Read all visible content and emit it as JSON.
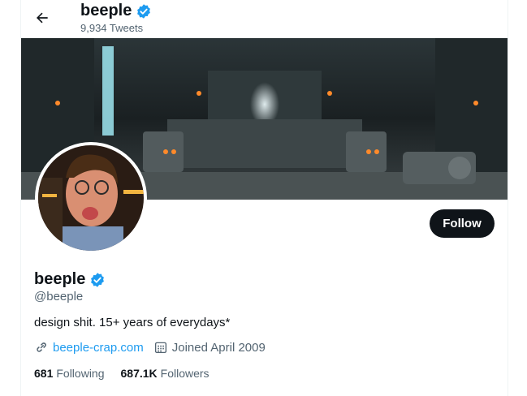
{
  "header": {
    "name": "beeple",
    "tweet_count": "9,934 Tweets"
  },
  "profile": {
    "display_name": "beeple",
    "handle": "@beeple",
    "bio": "design shit. 15+ years of everydays*",
    "website": "beeple-crap.com",
    "joined": "Joined April 2009",
    "following_count": "681",
    "following_label": "Following",
    "followers_count": "687.1K",
    "followers_label": "Followers"
  },
  "actions": {
    "follow_label": "Follow"
  },
  "icons": {
    "back": "arrow-left-icon",
    "verified": "verified-badge-icon",
    "link": "link-icon",
    "calendar": "calendar-icon"
  },
  "colors": {
    "accent": "#1d9bf0",
    "text": "#0f1419",
    "secondary": "#536471",
    "follow_bg": "#0f1419"
  }
}
